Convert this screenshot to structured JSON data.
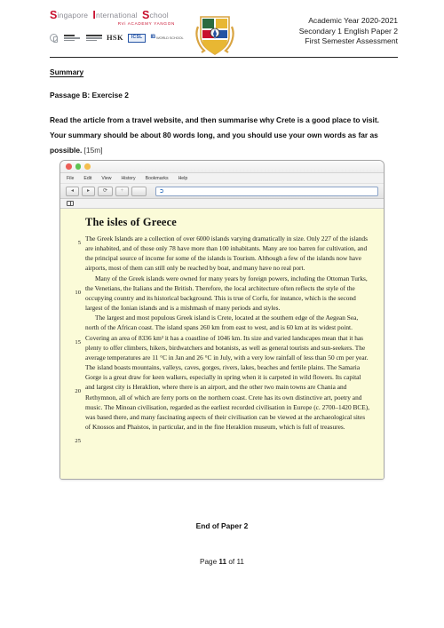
{
  "header": {
    "logo": {
      "word1_cap": "S",
      "word1_rest": "ingapore",
      "word2_cap": "I",
      "word2_rest": "nternational",
      "word3_cap": "S",
      "word3_rest": "chool",
      "subtitle": "RVi ACADEMY YANGON"
    },
    "accreditations": [
      {
        "name": "accreditation-seal",
        "label": ""
      },
      {
        "name": "accreditation-cambridge",
        "label": ""
      },
      {
        "name": "accreditation-hsk",
        "label": "HSK"
      },
      {
        "name": "accreditation-icsl",
        "label": "ICSL"
      },
      {
        "name": "accreditation-ib",
        "label": "IB"
      }
    ],
    "crest_alt": "school-crest",
    "right_lines": [
      "Academic Year 2020-2021",
      "Secondary 1 English Paper 2",
      "First Semester Assessment"
    ]
  },
  "question": {
    "section_title": "Summary",
    "passage_label": "Passage B: Exercise 2",
    "instruction": "Read the article from a travel website, and then summarise why Crete is a good place to visit. Your summary should be about 80 words long, and you should use your own words as far as possible.",
    "marks": "[15m]"
  },
  "browser": {
    "traffic_lights": [
      "close",
      "minimize",
      "zoom"
    ],
    "menu_items": [
      "File",
      "Edit",
      "View",
      "History",
      "Bookmarks",
      "Help"
    ],
    "toolbar_buttons": [
      "back",
      "forward",
      "reload",
      "add",
      "blank"
    ],
    "toolbar_glyphs": [
      "◂",
      "▸",
      "⟳",
      "+",
      ""
    ],
    "url_value": "",
    "url_icon": "➲",
    "bookmark_icon": "bookmark"
  },
  "article": {
    "title": "The isles of Greece",
    "paragraphs": [
      "The Greek Islands are a collection of over 6000 islands varying dramatically in size. Only 227 of the islands are inhabited, and of those only 78 have more than 100 inhabitants. Many are too barren for cultivation, and the principal source of income for some of the islands is Tourism.  Although a few of the islands now have airports, most of them can still only be reached by boat, and many have no real port.",
      "Many of the Greek islands were owned for many years by foreign powers, including the Ottoman Turks, the Venetians, the Italians and the British. Therefore, the local architecture often reflects the style of the occupying country and its historical background. This is true of Corfu, for instance, which is the second largest of the Ionian islands and is a mishmash of many periods and styles.",
      "The largest and most populous Greek island is Crete, located at the southern edge of the Aegean Sea, north of the African coast. The island spans 260 km from east to west, and is 60 km at its widest point. Covering an area of 8336 km² it has a coastline of 1046 km. Its size and varied landscapes mean that it has plenty to offer climbers, hikers, birdwatchers and botanists, as well as general tourists and sun-seekers. The average temperatures are 11 °C in Jan and 26 °C in July, with a very low rainfall of less than 50 cm per year. The island boasts mountains, valleys, caves, gorges, rivers, lakes, beaches and fertile plains. The Samaria Gorge is a great draw for keen walkers, especially in spring when it is carpeted in wild flowers. Its capital and largest city is Heraklion, where there is an airport, and the other two main towns are Chania and Rethymnon, all of which are ferry ports on the northern coast. Crete has its own distinctive art, poetry and music. The Minoan civilisation, regarded as the earliest recorded civilisation in Europe (c. 2700–1420 BCE), was based there, and many fascinating aspects of their civilisation can be viewed at the archaeological sites of Knossos and Phaistos, in particular, and in the fine Heraklion museum, which is full of treasures."
    ],
    "line_numbers": [
      "5",
      "10",
      "15",
      "20",
      "25"
    ]
  },
  "footer": {
    "end_text": "End of Paper 2",
    "page_prefix": "Page ",
    "page_current": "11",
    "page_mid": " of ",
    "page_total": "11"
  },
  "colors": {
    "logo_red": "#c8102e",
    "article_bg": "#fbfbd8",
    "rule": "#262626"
  }
}
